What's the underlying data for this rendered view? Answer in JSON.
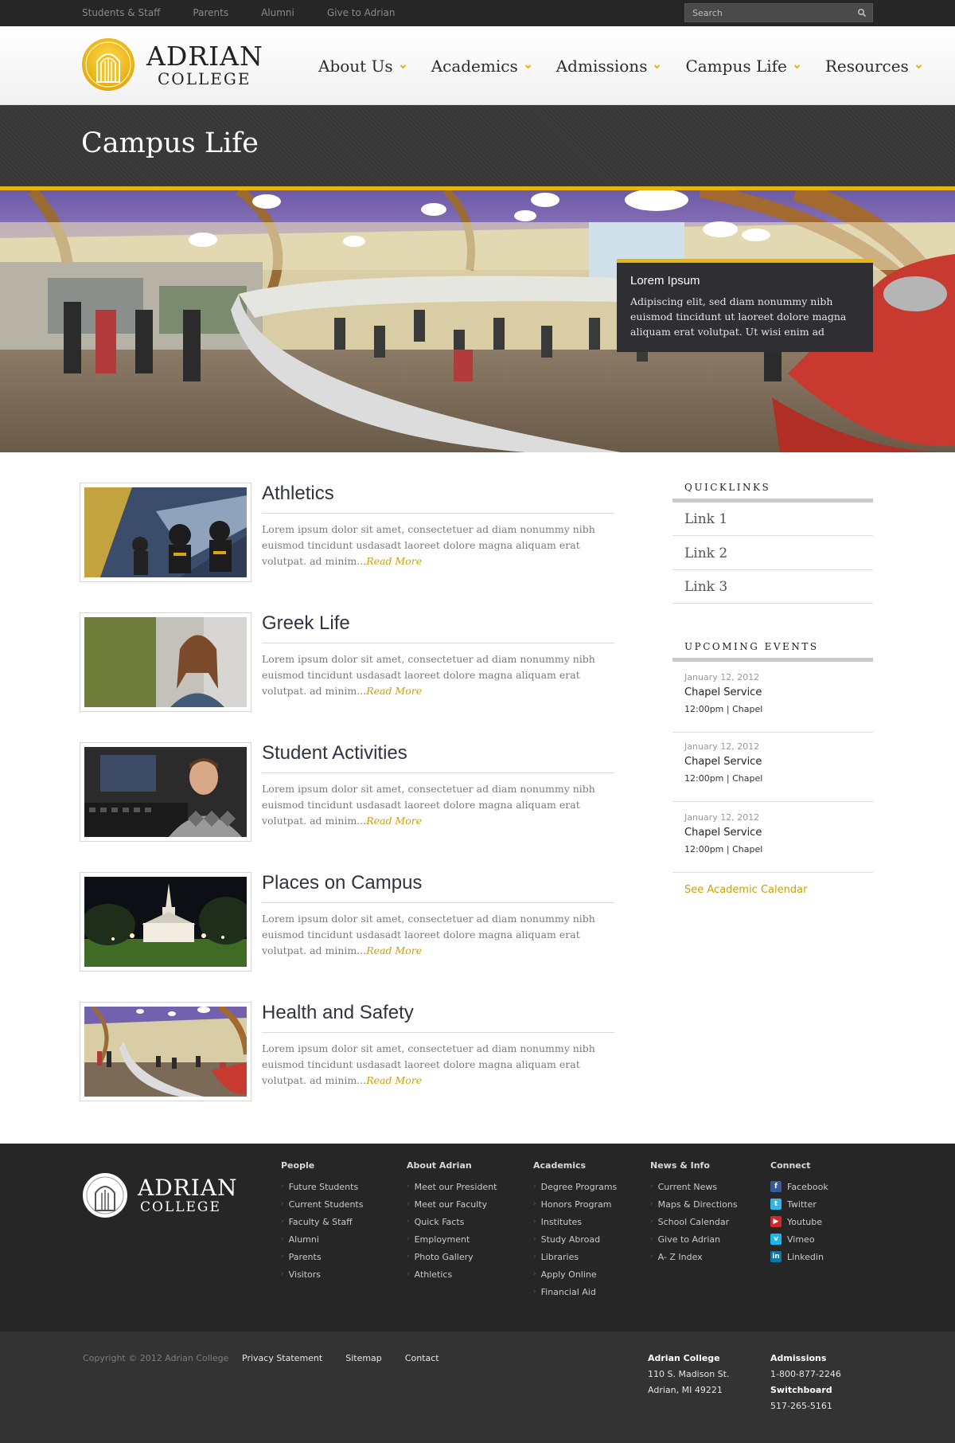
{
  "utility": {
    "links": [
      "Students & Staff",
      "Parents",
      "Alumni",
      "Give to Adrian"
    ],
    "search_placeholder": "Search",
    "search_icon": "search-icon"
  },
  "header": {
    "logo_line1": "ADRIAN",
    "logo_line2": "COLLEGE",
    "nav": [
      "About Us",
      "Academics",
      "Admissions",
      "Campus Life",
      "Resources"
    ]
  },
  "page": {
    "title": "Campus Life"
  },
  "hero": {
    "card_title": "Lorem Ipsum",
    "card_text": "Adipiscing elit, sed diam nonummy nibh euismod tincidunt ut laoreet dolore magna aliquam erat volutpat. Ut wisi enim ad"
  },
  "articles": [
    {
      "title": "Athletics",
      "excerpt": "Lorem ipsum dolor sit amet, consectetuer ad diam nonummy nibh euismod tincidunt usdasadt laoreet dolore magna aliquam erat volutpat.  ad minim...",
      "more": "Read More"
    },
    {
      "title": "Greek Life",
      "excerpt": "Lorem ipsum dolor sit amet, consectetuer ad diam nonummy nibh euismod tincidunt usdasadt laoreet dolore magna aliquam erat volutpat.  ad minim...",
      "more": "Read More"
    },
    {
      "title": "Student Activities",
      "excerpt": "Lorem ipsum dolor sit amet, consectetuer ad diam nonummy nibh euismod tincidunt usdasadt laoreet dolore magna aliquam erat volutpat.  ad minim...",
      "more": "Read More"
    },
    {
      "title": "Places on Campus",
      "excerpt": "Lorem ipsum dolor sit amet, consectetuer ad diam nonummy nibh euismod tincidunt usdasadt laoreet dolore magna aliquam erat volutpat.  ad minim...",
      "more": "Read More"
    },
    {
      "title": "Health and Safety",
      "excerpt": "Lorem ipsum dolor sit amet, consectetuer ad diam nonummy nibh euismod tincidunt usdasadt laoreet dolore magna aliquam erat volutpat.  ad minim...",
      "more": "Read More"
    }
  ],
  "sidebar": {
    "quicklinks_heading": "QUICKLINKS",
    "quicklinks": [
      "Link 1",
      "Link 2",
      "Link 3"
    ],
    "events_heading": "UPCOMING EVENTS",
    "events": [
      {
        "date": "January 12, 2012",
        "name": "Chapel Service",
        "meta": "12:00pm | Chapel"
      },
      {
        "date": "January 12, 2012",
        "name": "Chapel Service",
        "meta": "12:00pm | Chapel"
      },
      {
        "date": "January 12, 2012",
        "name": "Chapel Service",
        "meta": "12:00pm | Chapel"
      }
    ],
    "calendar_link": "See Academic Calendar"
  },
  "footer": {
    "logo_line1": "ADRIAN",
    "logo_line2": "COLLEGE",
    "columns": [
      {
        "heading": "People",
        "items": [
          "Future Students",
          "Current Students",
          "Faculty & Staff",
          "Alumni",
          "Parents",
          "Visitors"
        ]
      },
      {
        "heading": "About Adrian",
        "items": [
          "Meet our President",
          "Meet our Faculty",
          "Quick Facts",
          "Employment",
          "Photo Gallery",
          "Athletics"
        ]
      },
      {
        "heading": "Academics",
        "items": [
          "Degree Programs",
          "Honors Program",
          "Institutes",
          "Study Abroad",
          "Libraries",
          "Apply Online",
          "Financial Aid"
        ]
      },
      {
        "heading": "News & Info",
        "items": [
          "Current News",
          "Maps & Directions",
          "School Calendar",
          "Give to Adrian",
          "A- Z Index"
        ]
      }
    ],
    "connect": {
      "heading": "Connect",
      "items": [
        {
          "label": "Facebook",
          "icon": "facebook-icon",
          "color": "#3b5998"
        },
        {
          "label": "Twitter",
          "icon": "twitter-icon",
          "color": "#33b5e5"
        },
        {
          "label": "Youtube",
          "icon": "youtube-icon",
          "color": "#cc2a2a"
        },
        {
          "label": "Vimeo",
          "icon": "vimeo-icon",
          "color": "#1ab7ea"
        },
        {
          "label": "Linkedin",
          "icon": "linkedin-icon",
          "color": "#0e76a8"
        }
      ]
    }
  },
  "subfooter": {
    "copyright": "Copyright © 2012 Adrian College",
    "links": [
      "Privacy Statement",
      "Sitemap",
      "Contact"
    ],
    "address": {
      "name": "Adrian College",
      "line1": "110 S. Madison St.",
      "line2": "Adrian, MI 49221"
    },
    "contacts": {
      "admissions_label": "Admissions",
      "admissions_phone": "1-800-877-2246",
      "switchboard_label": "Switchboard",
      "switchboard_phone": "517-265-5161"
    }
  },
  "colors": {
    "accent": "#e8b410",
    "dark": "#262626",
    "link": "#c8a00e"
  }
}
